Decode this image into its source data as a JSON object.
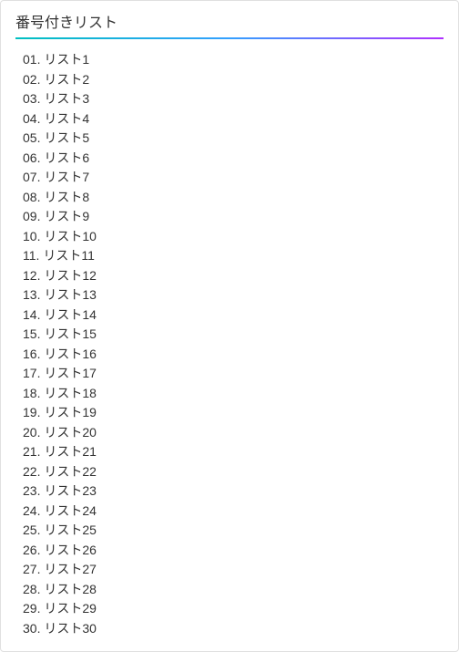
{
  "heading": "番号付きリスト",
  "items": [
    {
      "label": "リスト1"
    },
    {
      "label": "リスト2"
    },
    {
      "label": "リスト3"
    },
    {
      "label": "リスト4"
    },
    {
      "label": "リスト5"
    },
    {
      "label": "リスト6"
    },
    {
      "label": "リスト7"
    },
    {
      "label": "リスト8"
    },
    {
      "label": "リスト9"
    },
    {
      "label": "リスト10"
    },
    {
      "label": "リスト11"
    },
    {
      "label": "リスト12"
    },
    {
      "label": "リスト13"
    },
    {
      "label": "リスト14"
    },
    {
      "label": "リスト15"
    },
    {
      "label": "リスト16"
    },
    {
      "label": "リスト17"
    },
    {
      "label": "リスト18"
    },
    {
      "label": "リスト19"
    },
    {
      "label": "リスト20"
    },
    {
      "label": "リスト21"
    },
    {
      "label": "リスト22"
    },
    {
      "label": "リスト23"
    },
    {
      "label": "リスト24"
    },
    {
      "label": "リスト25"
    },
    {
      "label": "リスト26"
    },
    {
      "label": "リスト27"
    },
    {
      "label": "リスト28"
    },
    {
      "label": "リスト29"
    },
    {
      "label": "リスト30"
    }
  ]
}
